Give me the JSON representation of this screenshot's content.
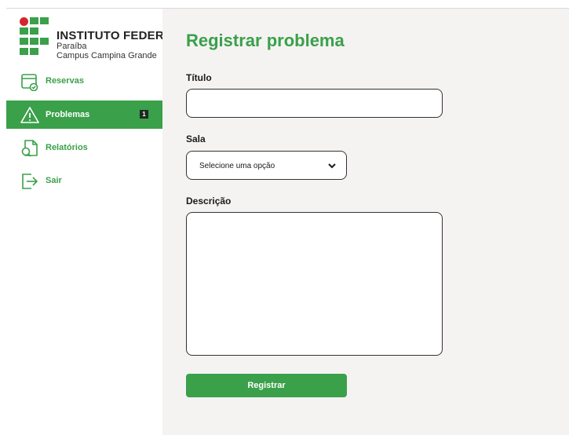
{
  "logo": {
    "title": "INSTITUTO FEDERAL",
    "line1": "Paraíba",
    "line2": "Campus Campina Grande",
    "colors": {
      "green": "#3aa04a",
      "red": "#d3262c"
    }
  },
  "sidebar": {
    "items": [
      {
        "label": "Reservas",
        "icon": "calendar-check-icon"
      },
      {
        "label": "Problemas",
        "icon": "warning-icon",
        "badge": "1",
        "active": true
      },
      {
        "label": "Relatórios",
        "icon": "report-search-icon"
      },
      {
        "label": "Sair",
        "icon": "logout-icon"
      }
    ]
  },
  "form": {
    "title": "Registrar problema",
    "titulo_label": "Título",
    "titulo_value": "",
    "sala_label": "Sala",
    "sala_selected": "Selecione uma opção",
    "descricao_label": "Descrição",
    "descricao_value": "",
    "submit_label": "Registrar"
  },
  "theme": {
    "accent": "#3aa04a",
    "background": "#f4f3f2"
  }
}
